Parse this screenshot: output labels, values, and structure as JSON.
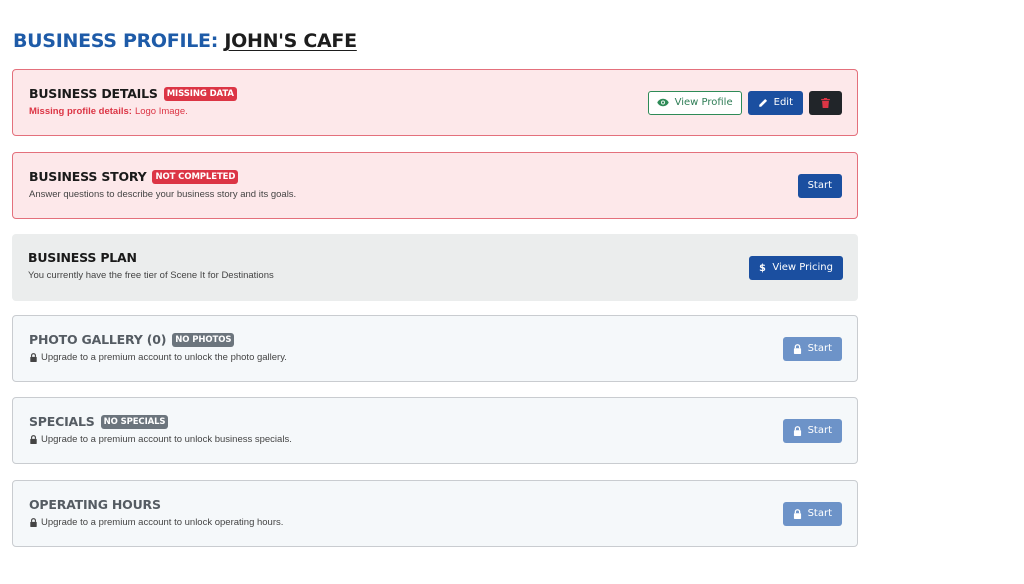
{
  "page": {
    "title_prefix": "BUSINESS PROFILE:",
    "business_name": "JOHN'S CAFE"
  },
  "cards": {
    "details": {
      "title": "BUSINESS DETAILS",
      "badge": "MISSING DATA",
      "missing_label": "Missing profile details:",
      "missing_items": "Logo Image.",
      "view_profile_label": "View Profile",
      "edit_label": "Edit"
    },
    "story": {
      "title": "BUSINESS STORY",
      "badge": "NOT COMPLETED",
      "description": "Answer questions to describe your business story and its goals.",
      "start_label": "Start"
    },
    "plan": {
      "title": "BUSINESS PLAN",
      "description": "You currently have the free tier of Scene It for Destinations",
      "pricing_label": "View Pricing"
    },
    "gallery": {
      "title": "PHOTO GALLERY (0)",
      "badge": "NO PHOTOS",
      "description": "Upgrade to a premium account to unlock the photo gallery.",
      "start_label": "Start"
    },
    "specials": {
      "title": "SPECIALS",
      "badge": "NO SPECIALS",
      "description": "Upgrade to a premium account to unlock business specials.",
      "start_label": "Start"
    },
    "hours": {
      "title": "OPERATING HOURS",
      "description": "Upgrade to a premium account to unlock operating hours.",
      "start_label": "Start"
    }
  },
  "icons": {
    "view": "eye-icon",
    "edit": "pencil-icon",
    "delete": "trash-icon",
    "pricing": "dollar-icon",
    "locked": "lock-icon"
  },
  "colors": {
    "title_blue": "#1e5ba8",
    "primary": "#1b4fa0",
    "danger": "#dc3545",
    "success": "#2e8b57",
    "alert_bg": "#fde8ea",
    "disabled_primary": "#6d93c8"
  }
}
